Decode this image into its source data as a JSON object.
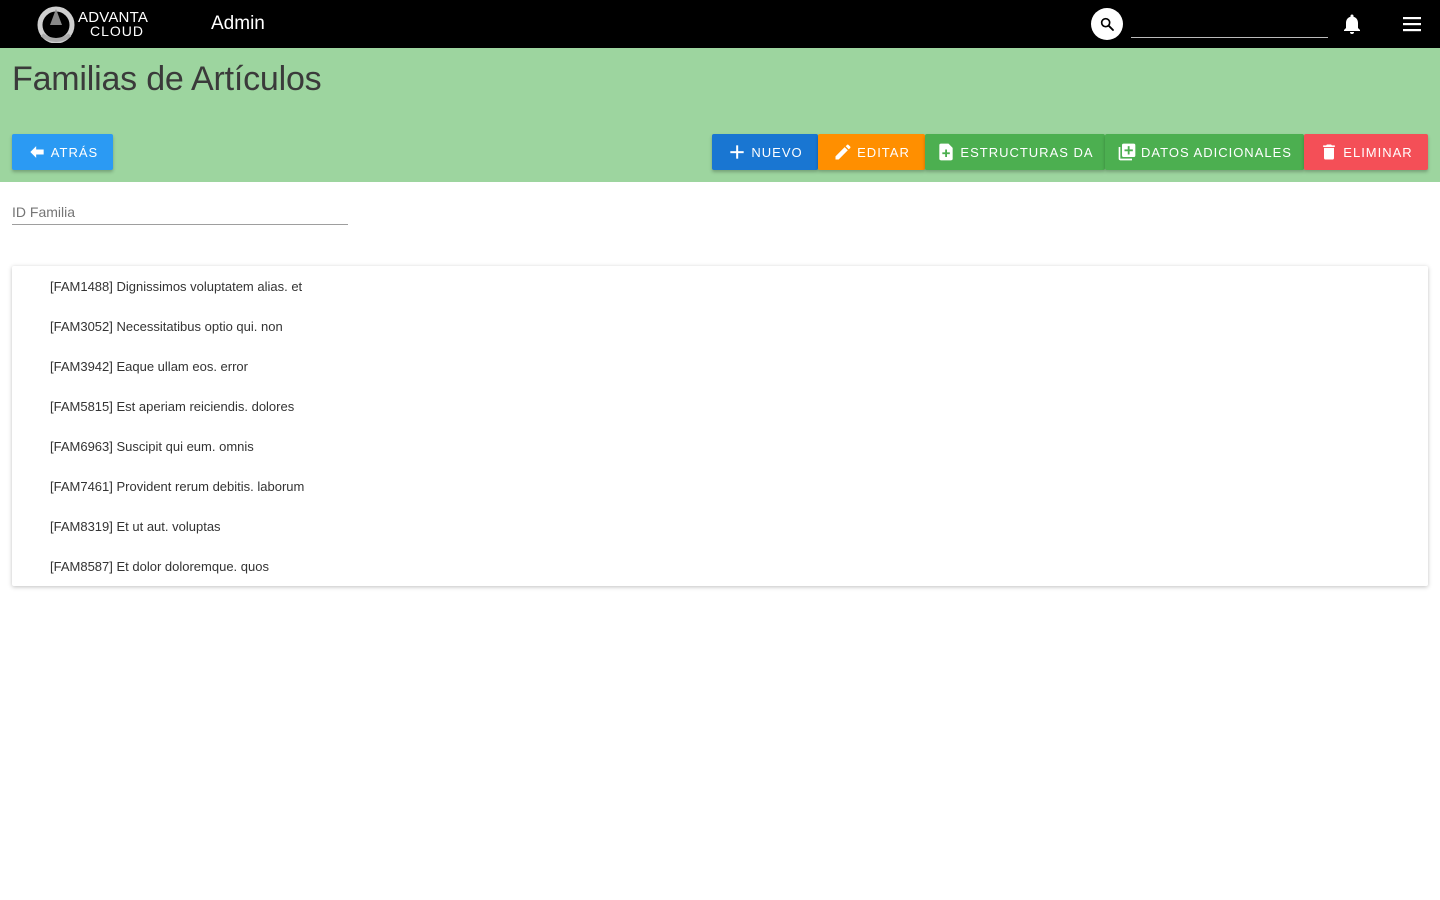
{
  "topbar": {
    "logo_line1": "ADVANTA",
    "logo_line2": "CLOUD",
    "app_title": "Admin",
    "search_placeholder": "",
    "icons": [
      "search-icon",
      "bell-icon",
      "menu-icon"
    ]
  },
  "header": {
    "title": "Familias de Artículos",
    "back_label": "ATRÁS",
    "new_label": "NUEVO",
    "edit_label": "EDITAR",
    "structures_label": "ESTRUCTURAS DA",
    "extra_data_label": "DATOS ADICIONALES",
    "delete_label": "ELIMINAR"
  },
  "filter": {
    "placeholder": "ID Familia"
  },
  "families": [
    "[FAM1488] Dignissimos voluptatem alias. et",
    "[FAM3052] Necessitatibus optio qui. non",
    "[FAM3942] Eaque ullam eos. error",
    "[FAM5815] Est aperiam reiciendis. dolores",
    "[FAM6963] Suscipit qui eum. omnis",
    "[FAM7461] Provident rerum debitis. laborum",
    "[FAM8319] Et ut aut. voluptas",
    "[FAM8587] Et dolor doloremque. quos"
  ],
  "colors": {
    "topbar": "#000000",
    "band": "#9dd59f",
    "back": "#2b9af3",
    "new": "#1976d2",
    "edit": "#ff8f00",
    "green": "#4caf50",
    "delete": "#f44f57"
  }
}
